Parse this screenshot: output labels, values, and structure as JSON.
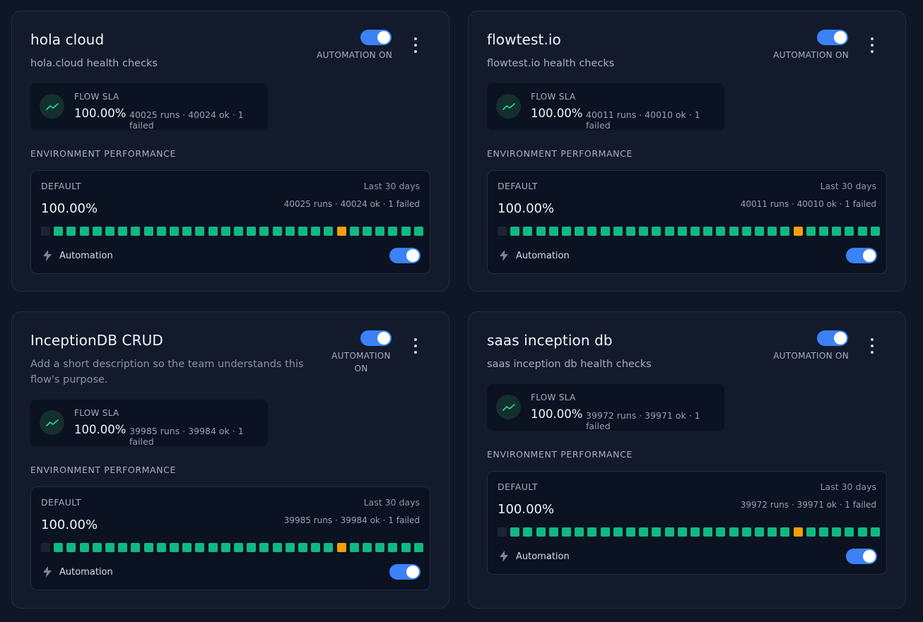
{
  "colors": {
    "ok": "#10b981",
    "failed": "#f59e0b",
    "empty": "#1b2335",
    "accent": "#3b82f6"
  },
  "cards": [
    {
      "title": "hola cloud",
      "description": "hola.cloud health checks",
      "automation_label": "AUTOMATION ON",
      "sla_label": "FLOW SLA",
      "sla_pct": "100.00%",
      "sla_stats": "40025 runs · 40024 ok · 1 failed",
      "env_section_title": "ENVIRONMENT PERFORMANCE",
      "env": {
        "name": "DEFAULT",
        "period": "Last 30 days",
        "pct": "100.00%",
        "stats": "40025 runs · 40024 ok · 1 failed",
        "automation_label": "Automation",
        "days": [
          "empty",
          "ok",
          "ok",
          "ok",
          "ok",
          "ok",
          "ok",
          "ok",
          "ok",
          "ok",
          "ok",
          "ok",
          "ok",
          "ok",
          "ok",
          "ok",
          "ok",
          "ok",
          "ok",
          "ok",
          "ok",
          "ok",
          "ok",
          "failed",
          "ok",
          "ok",
          "ok",
          "ok",
          "ok",
          "ok"
        ]
      }
    },
    {
      "title": "flowtest.io",
      "description": "flowtest.io health checks",
      "automation_label": "AUTOMATION ON",
      "sla_label": "FLOW SLA",
      "sla_pct": "100.00%",
      "sla_stats": "40011 runs · 40010 ok · 1 failed",
      "env_section_title": "ENVIRONMENT PERFORMANCE",
      "env": {
        "name": "DEFAULT",
        "period": "Last 30 days",
        "pct": "100.00%",
        "stats": "40011 runs · 40010 ok · 1 failed",
        "automation_label": "Automation",
        "days": [
          "empty",
          "ok",
          "ok",
          "ok",
          "ok",
          "ok",
          "ok",
          "ok",
          "ok",
          "ok",
          "ok",
          "ok",
          "ok",
          "ok",
          "ok",
          "ok",
          "ok",
          "ok",
          "ok",
          "ok",
          "ok",
          "ok",
          "ok",
          "failed",
          "ok",
          "ok",
          "ok",
          "ok",
          "ok",
          "ok"
        ]
      }
    },
    {
      "title": "InceptionDB CRUD",
      "description": "Add a short description so the team understands this flow's purpose.",
      "automation_label": "AUTOMATION ON",
      "sla_label": "FLOW SLA",
      "sla_pct": "100.00%",
      "sla_stats": "39985 runs · 39984 ok · 1 failed",
      "env_section_title": "ENVIRONMENT PERFORMANCE",
      "env": {
        "name": "DEFAULT",
        "period": "Last 30 days",
        "pct": "100.00%",
        "stats": "39985 runs · 39984 ok · 1 failed",
        "automation_label": "Automation",
        "days": [
          "empty",
          "ok",
          "ok",
          "ok",
          "ok",
          "ok",
          "ok",
          "ok",
          "ok",
          "ok",
          "ok",
          "ok",
          "ok",
          "ok",
          "ok",
          "ok",
          "ok",
          "ok",
          "ok",
          "ok",
          "ok",
          "ok",
          "ok",
          "failed",
          "ok",
          "ok",
          "ok",
          "ok",
          "ok",
          "ok"
        ]
      }
    },
    {
      "title": "saas inception db",
      "description": "saas inception db health checks",
      "automation_label": "AUTOMATION ON",
      "sla_label": "FLOW SLA",
      "sla_pct": "100.00%",
      "sla_stats": "39972 runs · 39971 ok · 1 failed",
      "env_section_title": "ENVIRONMENT PERFORMANCE",
      "env": {
        "name": "DEFAULT",
        "period": "Last 30 days",
        "pct": "100.00%",
        "stats": "39972 runs · 39971 ok · 1 failed",
        "automation_label": "Automation",
        "days": [
          "empty",
          "ok",
          "ok",
          "ok",
          "ok",
          "ok",
          "ok",
          "ok",
          "ok",
          "ok",
          "ok",
          "ok",
          "ok",
          "ok",
          "ok",
          "ok",
          "ok",
          "ok",
          "ok",
          "ok",
          "ok",
          "ok",
          "ok",
          "failed",
          "ok",
          "ok",
          "ok",
          "ok",
          "ok",
          "ok"
        ]
      }
    }
  ]
}
